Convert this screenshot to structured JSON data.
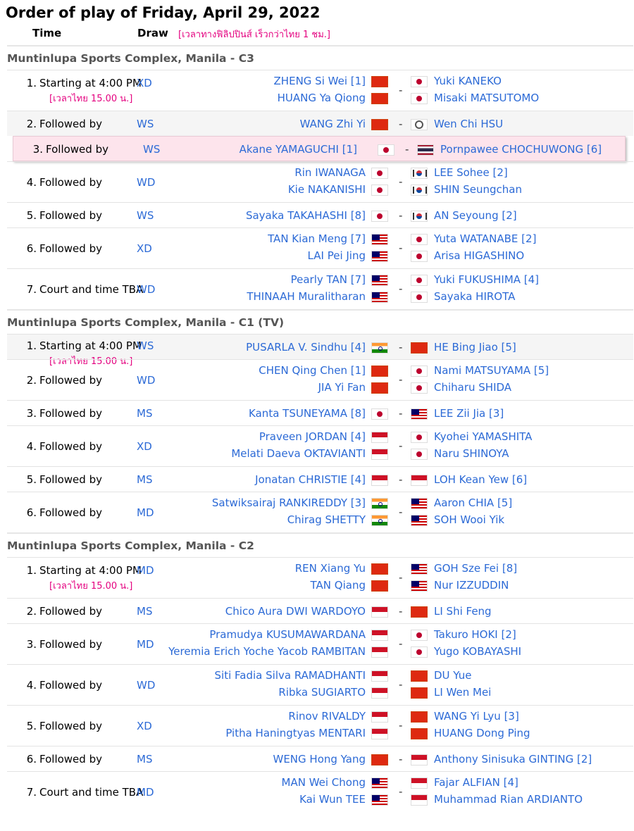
{
  "title": "Order of play of Friday, April 29, 2022",
  "header": {
    "time": "Time",
    "draw": "Draw",
    "note": "[เวลาทางฟิลิปปินส์ เร็วกว่าไทย 1 ชม.]"
  },
  "thai_time": "[เวลาไทย 15.00 น.]",
  "dash": "-",
  "courts": [
    {
      "name": "Muntinlupa Sports Complex, Manila - C3",
      "matches": [
        {
          "num": "1.",
          "time": "Starting at 4:00 PM",
          "draw": "XD",
          "left": [
            "ZHENG Si Wei [1]",
            "HUANG Ya Qiong"
          ],
          "lflag": "cn",
          "right": [
            "Yuki KANEKO",
            "Misaki MATSUTOMO"
          ],
          "rflag": "jp"
        },
        {
          "num": "2.",
          "time": "Followed by",
          "draw": "WS",
          "left": [
            "WANG Zhi Yi"
          ],
          "lflag": "cn",
          "right": [
            "Wen Chi HSU"
          ],
          "rflag": "tpe"
        },
        {
          "num": "3.",
          "time": "Followed by",
          "draw": "WS",
          "left": [
            "Akane YAMAGUCHI [1]"
          ],
          "lflag": "jp",
          "right": [
            "Pornpawee CHOCHUWONG [6]"
          ],
          "rflag": "th"
        },
        {
          "num": "4.",
          "time": "Followed by",
          "draw": "WD",
          "left": [
            "Rin IWANAGA",
            "Kie NAKANISHI"
          ],
          "lflag": "jp",
          "right": [
            "LEE Sohee [2]",
            "SHIN Seungchan"
          ],
          "rflag": "kr"
        },
        {
          "num": "5.",
          "time": "Followed by",
          "draw": "WS",
          "left": [
            "Sayaka TAKAHASHI [8]"
          ],
          "lflag": "jp",
          "right": [
            "AN Seyoung [2]"
          ],
          "rflag": "kr"
        },
        {
          "num": "6.",
          "time": "Followed by",
          "draw": "XD",
          "left": [
            "TAN Kian Meng [7]",
            "LAI Pei Jing"
          ],
          "lflag": "my",
          "right": [
            "Yuta WATANABE [2]",
            "Arisa HIGASHINO"
          ],
          "rflag": "jp"
        },
        {
          "num": "7.",
          "time": "Court and time TBA",
          "draw": "WD",
          "left": [
            "Pearly TAN [7]",
            "THINAAH Muralitharan"
          ],
          "lflag": "my",
          "right": [
            "Yuki FUKUSHIMA [4]",
            "Sayaka HIROTA"
          ],
          "rflag": "jp"
        }
      ]
    },
    {
      "name": "Muntinlupa Sports Complex, Manila - C1 (TV)",
      "matches": [
        {
          "num": "1.",
          "time": "Starting at 4:00 PM",
          "draw": "WS",
          "left": [
            "PUSARLA V. Sindhu [4]"
          ],
          "lflag": "in",
          "right": [
            "HE Bing Jiao [5]"
          ],
          "rflag": "cn"
        },
        {
          "num": "2.",
          "time": "Followed by",
          "draw": "WD",
          "left": [
            "CHEN Qing Chen [1]",
            "JIA Yi Fan"
          ],
          "lflag": "cn",
          "right": [
            "Nami MATSUYAMA [5]",
            "Chiharu SHIDA"
          ],
          "rflag": "jp"
        },
        {
          "num": "3.",
          "time": "Followed by",
          "draw": "MS",
          "left": [
            "Kanta TSUNEYAMA [8]"
          ],
          "lflag": "jp",
          "right": [
            "LEE Zii Jia [3]"
          ],
          "rflag": "my"
        },
        {
          "num": "4.",
          "time": "Followed by",
          "draw": "XD",
          "left": [
            "Praveen JORDAN [4]",
            "Melati Daeva OKTAVIANTI"
          ],
          "lflag": "id",
          "right": [
            "Kyohei YAMASHITA",
            "Naru SHINOYA"
          ],
          "rflag": "jp"
        },
        {
          "num": "5.",
          "time": "Followed by",
          "draw": "MS",
          "left": [
            "Jonatan CHRISTIE [4]"
          ],
          "lflag": "id",
          "right": [
            "LOH Kean Yew [6]"
          ],
          "rflag": "id"
        },
        {
          "num": "6.",
          "time": "Followed by",
          "draw": "MD",
          "left": [
            "Satwiksairaj RANKIREDDY [3]",
            "Chirag SHETTY"
          ],
          "lflag": "in",
          "right": [
            "Aaron CHIA [5]",
            "SOH Wooi Yik"
          ],
          "rflag": "my"
        }
      ]
    },
    {
      "name": "Muntinlupa Sports Complex, Manila - C2",
      "matches": [
        {
          "num": "1.",
          "time": "Starting at 4:00 PM",
          "draw": "MD",
          "left": [
            "REN Xiang Yu",
            "TAN Qiang"
          ],
          "lflag": "cn",
          "right": [
            "GOH Sze Fei [8]",
            "Nur IZZUDDIN"
          ],
          "rflag": "my"
        },
        {
          "num": "2.",
          "time": "Followed by",
          "draw": "MS",
          "left": [
            "Chico Aura DWI WARDOYO"
          ],
          "lflag": "id",
          "right": [
            "LI Shi Feng"
          ],
          "rflag": "cn"
        },
        {
          "num": "3.",
          "time": "Followed by",
          "draw": "MD",
          "left": [
            "Pramudya KUSUMAWARDANA",
            "Yeremia Erich Yoche Yacob RAMBITAN"
          ],
          "lflag": "id",
          "right": [
            "Takuro HOKI [2]",
            "Yugo KOBAYASHI"
          ],
          "rflag": "jp"
        },
        {
          "num": "4.",
          "time": "Followed by",
          "draw": "WD",
          "left": [
            "Siti Fadia Silva RAMADHANTI",
            "Ribka SUGIARTO"
          ],
          "lflag": "id",
          "right": [
            "DU Yue",
            "LI Wen Mei"
          ],
          "rflag": "cn"
        },
        {
          "num": "5.",
          "time": "Followed by",
          "draw": "XD",
          "left": [
            "Rinov RIVALDY",
            "Pitha Haningtyas MENTARI"
          ],
          "lflag": "id",
          "right": [
            "WANG Yi Lyu [3]",
            "HUANG Dong Ping"
          ],
          "rflag": "cn"
        },
        {
          "num": "6.",
          "time": "Followed by",
          "draw": "MS",
          "left": [
            "WENG Hong Yang"
          ],
          "lflag": "cn",
          "right": [
            "Anthony Sinisuka GINTING [2]"
          ],
          "rflag": "id"
        },
        {
          "num": "7.",
          "time": "Court and time TBA",
          "draw": "MD",
          "left": [
            "MAN Wei Chong",
            "Kai Wun TEE"
          ],
          "lflag": "my",
          "right": [
            "Fajar ALFIAN [4]",
            "Muhammad Rian ARDIANTO"
          ],
          "rflag": "id"
        }
      ]
    }
  ]
}
